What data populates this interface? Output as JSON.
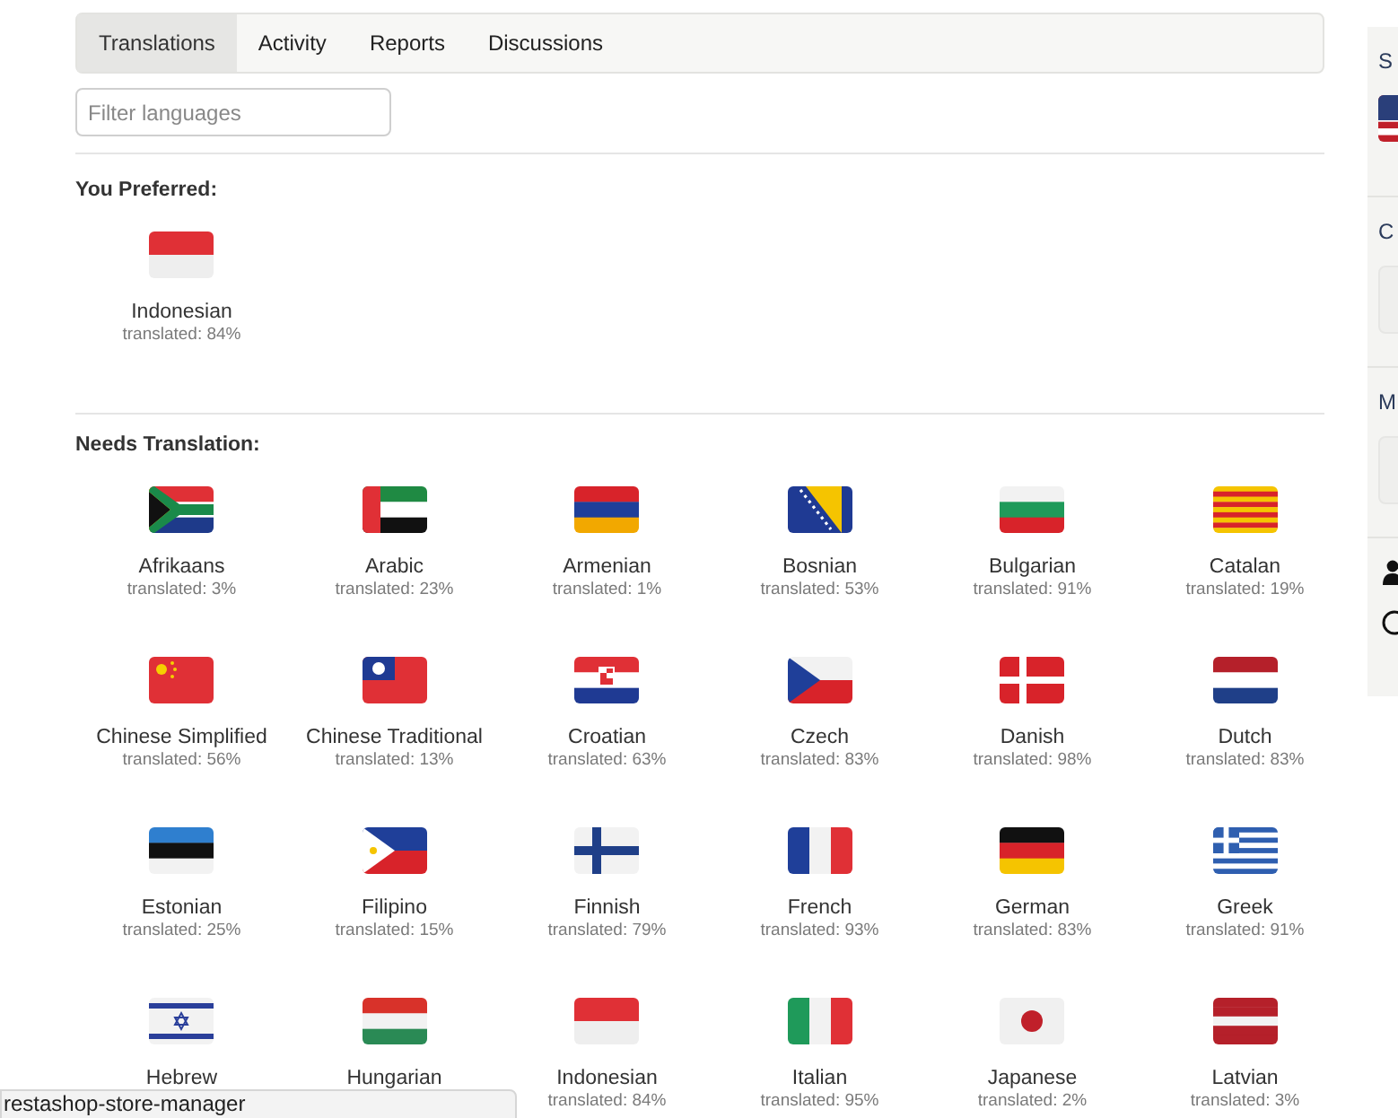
{
  "tabs": [
    {
      "label": "Translations",
      "selected": true
    },
    {
      "label": "Activity",
      "selected": false
    },
    {
      "label": "Reports",
      "selected": false
    },
    {
      "label": "Discussions",
      "selected": false
    }
  ],
  "filter": {
    "placeholder": "Filter languages"
  },
  "preferred": {
    "heading": "You Preferred:",
    "languages": [
      {
        "name": "Indonesian",
        "progress": "translated: 84%",
        "kind": "id"
      }
    ]
  },
  "needs_translation": {
    "heading": "Needs Translation:",
    "languages": [
      {
        "name": "Afrikaans",
        "progress": "translated: 3%",
        "kind": "za"
      },
      {
        "name": "Arabic",
        "progress": "translated: 23%",
        "kind": "ae"
      },
      {
        "name": "Armenian",
        "progress": "translated: 1%",
        "kind": "am"
      },
      {
        "name": "Bosnian",
        "progress": "translated: 53%",
        "kind": "ba"
      },
      {
        "name": "Bulgarian",
        "progress": "translated: 91%",
        "kind": "bg"
      },
      {
        "name": "Catalan",
        "progress": "translated: 19%",
        "kind": "cat"
      },
      {
        "name": "Chinese Simplified",
        "progress": "translated: 56%",
        "kind": "cn"
      },
      {
        "name": "Chinese Traditional",
        "progress": "translated: 13%",
        "kind": "tw"
      },
      {
        "name": "Croatian",
        "progress": "translated: 63%",
        "kind": "hr"
      },
      {
        "name": "Czech",
        "progress": "translated: 83%",
        "kind": "cz"
      },
      {
        "name": "Danish",
        "progress": "translated: 98%",
        "kind": "dk"
      },
      {
        "name": "Dutch",
        "progress": "translated: 83%",
        "kind": "nl"
      },
      {
        "name": "Estonian",
        "progress": "translated: 25%",
        "kind": "ee"
      },
      {
        "name": "Filipino",
        "progress": "translated: 15%",
        "kind": "ph"
      },
      {
        "name": "Finnish",
        "progress": "translated: 79%",
        "kind": "fi"
      },
      {
        "name": "French",
        "progress": "translated: 93%",
        "kind": "fr"
      },
      {
        "name": "German",
        "progress": "translated: 83%",
        "kind": "de"
      },
      {
        "name": "Greek",
        "progress": "translated: 91%",
        "kind": "gr"
      },
      {
        "name": "Hebrew",
        "kind": "il"
      },
      {
        "name": "Hungarian",
        "kind": "hu"
      },
      {
        "name": "Indonesian",
        "progress": "translated: 84%",
        "kind": "id"
      },
      {
        "name": "Italian",
        "progress": "translated: 95%",
        "kind": "it"
      },
      {
        "name": "Japanese",
        "progress": "translated: 2%",
        "kind": "jp"
      },
      {
        "name": "Latvian",
        "progress": "translated: 3%",
        "kind": "lv"
      }
    ]
  },
  "sidebar": {
    "sections": [
      {
        "heading": "S"
      },
      {
        "heading": "C"
      },
      {
        "heading": "M"
      }
    ]
  },
  "status_url": "restashop-store-manager"
}
